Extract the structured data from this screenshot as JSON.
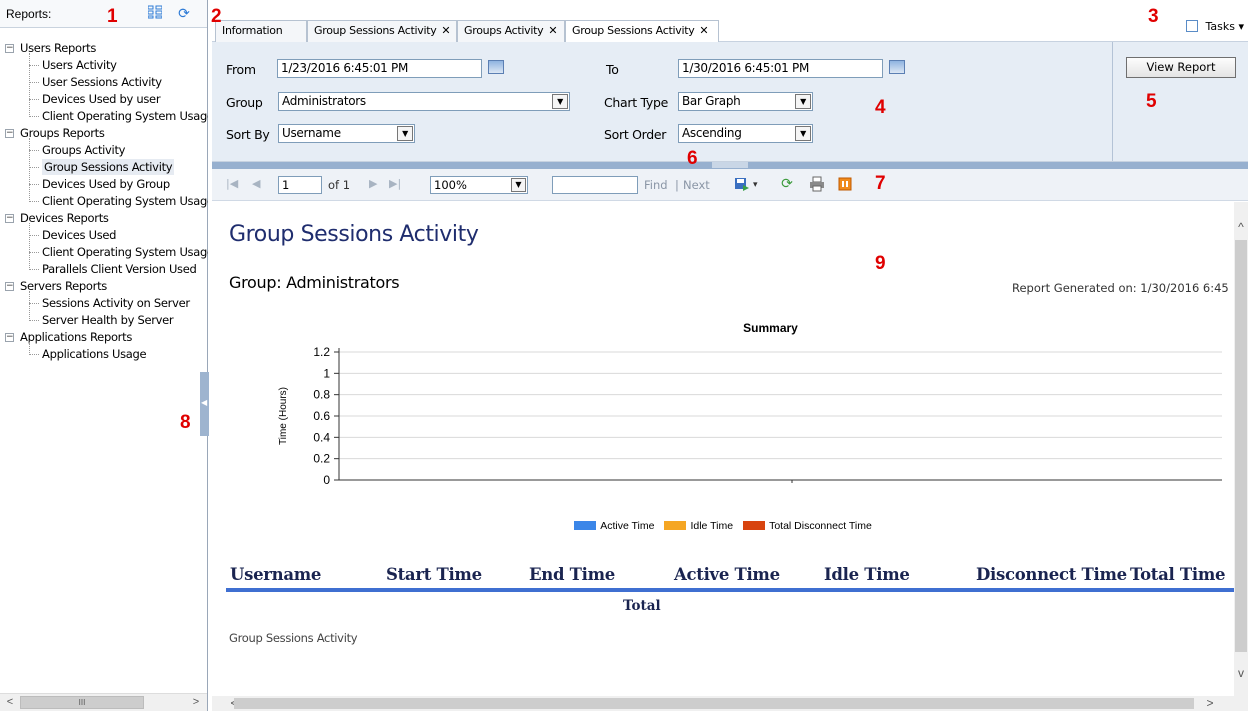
{
  "left_panel": {
    "title": "Reports:",
    "tree": [
      {
        "label": "Users Reports",
        "expander": "−",
        "children": [
          "Users Activity",
          "User Sessions Activity",
          "Devices Used by user",
          "Client Operating System Usage"
        ]
      },
      {
        "label": "Groups Reports",
        "expander": "−",
        "children": [
          "Groups Activity",
          "Group Sessions Activity",
          "Devices Used by Group",
          "Client Operating System Usage"
        ]
      },
      {
        "label": "Devices Reports",
        "expander": "−",
        "children": [
          "Devices Used",
          "Client Operating System Usage",
          "Parallels Client Version Used"
        ]
      },
      {
        "label": "Servers Reports",
        "expander": "−",
        "children": [
          "Sessions Activity on Server",
          "Server Health by Server"
        ]
      },
      {
        "label": "Applications Reports",
        "expander": "−",
        "children": [
          "Applications Usage"
        ]
      }
    ],
    "selected": "Group Sessions Activity",
    "scroll_thumb": "III"
  },
  "tabs": [
    {
      "label": "Information",
      "closable": false
    },
    {
      "label": "Group Sessions Activity",
      "closable": true
    },
    {
      "label": "Groups Activity",
      "closable": true
    },
    {
      "label": "Group Sessions Activity",
      "closable": true,
      "active": true
    }
  ],
  "tasks": {
    "label": "Tasks ▾"
  },
  "params": {
    "from_label": "From",
    "from_value": "1/23/2016 6:45:01 PM",
    "to_label": "To",
    "to_value": "1/30/2016 6:45:01 PM",
    "group_label": "Group",
    "group_value": "Administrators",
    "chart_type_label": "Chart Type",
    "chart_type_value": "Bar Graph",
    "sort_by_label": "Sort By",
    "sort_by_value": "Username",
    "sort_order_label": "Sort Order",
    "sort_order_value": "Ascending",
    "view_report": "View Report"
  },
  "toolbar": {
    "page": "1",
    "of_pages": "of 1",
    "zoom": "100%",
    "find_input": "",
    "find": "Find",
    "separator": "|",
    "next": "Next"
  },
  "report": {
    "title": "Group Sessions Activity",
    "group": "Group: Administrators",
    "generated": "Report Generated on: 1/30/2016 6:45",
    "columns": [
      "Username",
      "Start Time",
      "End Time",
      "Active Time",
      "Idle Time",
      "Disconnect Time",
      "Total Time"
    ],
    "total_label": "Total",
    "footer": "Group Sessions Activity"
  },
  "chart_data": {
    "type": "bar",
    "title": "Summary",
    "ylabel": "Time (Hours)",
    "xlabel": "",
    "ylim": [
      0,
      1.2
    ],
    "yticks": [
      "0",
      "0.2",
      "0.4",
      "0.6",
      "0.8",
      "1",
      "1.2"
    ],
    "categories": [],
    "series": [
      {
        "name": "Active Time",
        "color": "#3b86e8",
        "values": []
      },
      {
        "name": "Idle Time",
        "color": "#f5a623",
        "values": []
      },
      {
        "name": "Total Disconnect Time",
        "color": "#d8440f",
        "values": []
      }
    ],
    "grid": true,
    "legend": "bottom"
  },
  "markers": [
    "1",
    "2",
    "3",
    "4",
    "5",
    "6",
    "7",
    "8",
    "9"
  ],
  "colors": {
    "accent": "#3f6fd1",
    "title": "#1f2d6e",
    "marker": "#e00000"
  }
}
